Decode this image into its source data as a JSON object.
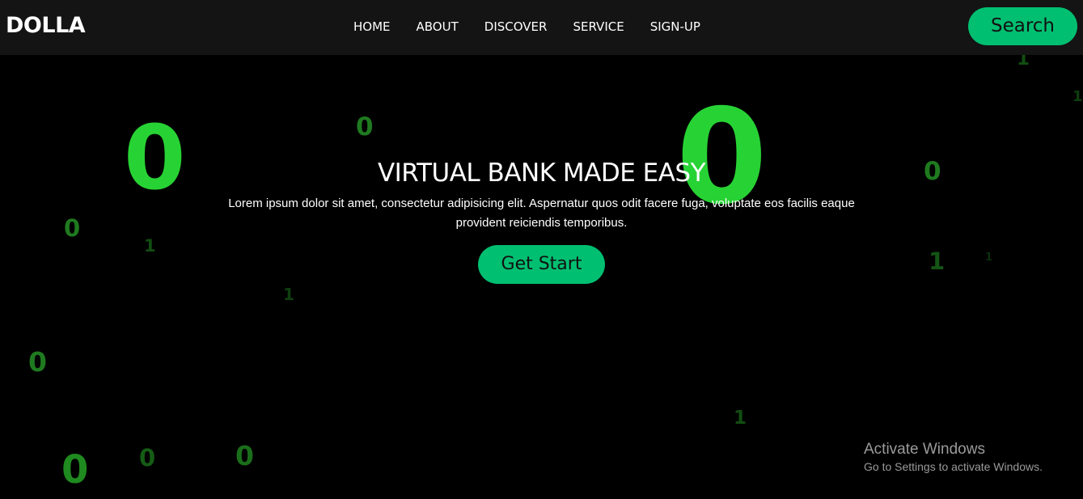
{
  "navbar": {
    "logo": "DOLLA",
    "links": [
      "HOME",
      "ABOUT",
      "DISCOVER",
      "SERVICE",
      "SIGN-UP"
    ],
    "search_label": "Search",
    "background_color": "#141414",
    "accent_color": "#01bf71"
  },
  "hero": {
    "title": "VIRTUAL BANK MADE EASY",
    "text": "Lorem ipsum dolor sit amet, consectetur adipisicing elit. Aspernatur quos odit facere fuga, voluptate eos facilis eaque provident reiciendis temporibus.",
    "button_label": "Get Start",
    "background_color": "#000000"
  },
  "binary_rain": {
    "digits": [
      "0",
      "0",
      "0",
      "0",
      "0",
      "0",
      "0",
      "0",
      "0",
      "1",
      "1",
      "1",
      "1",
      "1",
      "1",
      "1"
    ],
    "color": "#27d334"
  },
  "os_watermark": {
    "title": "Activate Windows",
    "subtitle": "Go to Settings to activate Windows."
  }
}
